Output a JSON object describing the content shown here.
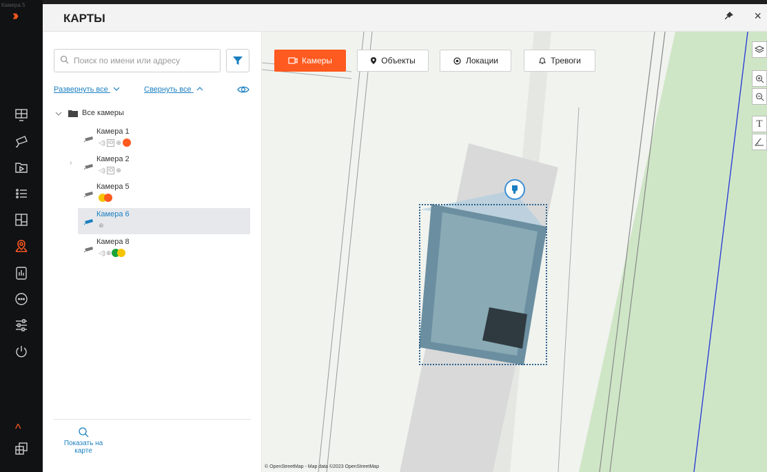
{
  "window": {
    "title": "КАРТЫ",
    "corner_tag": "Камера 5"
  },
  "titlebar": {
    "pin_icon": "pin-icon",
    "close_label": "×"
  },
  "rail": {
    "items": [
      {
        "icon": "monitor-layout-icon"
      },
      {
        "icon": "cctv-camera-icon"
      },
      {
        "icon": "video-archive-icon"
      },
      {
        "icon": "events-list-icon"
      },
      {
        "icon": "layout-grid-icon"
      },
      {
        "icon": "map-location-icon",
        "active": true
      },
      {
        "icon": "report-icon"
      },
      {
        "icon": "more-icon"
      },
      {
        "icon": "settings-sliders-icon"
      },
      {
        "icon": "power-icon"
      }
    ],
    "bottom_icon": "windows-icon"
  },
  "sidebar": {
    "search_placeholder": "Поиск по имени или адресу",
    "expand_all": "Развернуть все",
    "collapse_all": "Свернуть все",
    "root_label": "Все камеры",
    "cameras": [
      {
        "name": "Камера 1",
        "status": [
          "sound",
          "io",
          "ptz",
          "orange"
        ]
      },
      {
        "name": "Камера 2",
        "status": [
          "sound",
          "io",
          "ptz"
        ],
        "expandable": true
      },
      {
        "name": "Камера 5",
        "status": [
          "yellow",
          "orange"
        ]
      },
      {
        "name": "Камера 6",
        "status": [
          "ptz"
        ],
        "selected": true
      },
      {
        "name": "Камера 8",
        "status": [
          "sound",
          "ptz",
          "green",
          "yellow"
        ]
      }
    ],
    "show_on_map": "Показать на карте"
  },
  "map": {
    "tabs": [
      {
        "label": "Камеры",
        "icon": "camera-icon",
        "active": true
      },
      {
        "label": "Объекты",
        "icon": "pin-marker-icon"
      },
      {
        "label": "Локации",
        "icon": "location-target-icon"
      },
      {
        "label": "Тревоги",
        "icon": "bell-icon"
      }
    ],
    "tools": [
      "layers-icon",
      "zoom-in-icon",
      "zoom-out-icon",
      "text-tool-icon",
      "angle-tool-icon"
    ],
    "attribution": "© OpenStreetMap - Map data ©2023 OpenStreetMap"
  },
  "colors": {
    "accent": "#ff5a1f",
    "link": "#1a7fc0",
    "selected_bg": "#e6e8ec",
    "green_zone": "#cfe6c6",
    "building": "#d9d9d9"
  }
}
